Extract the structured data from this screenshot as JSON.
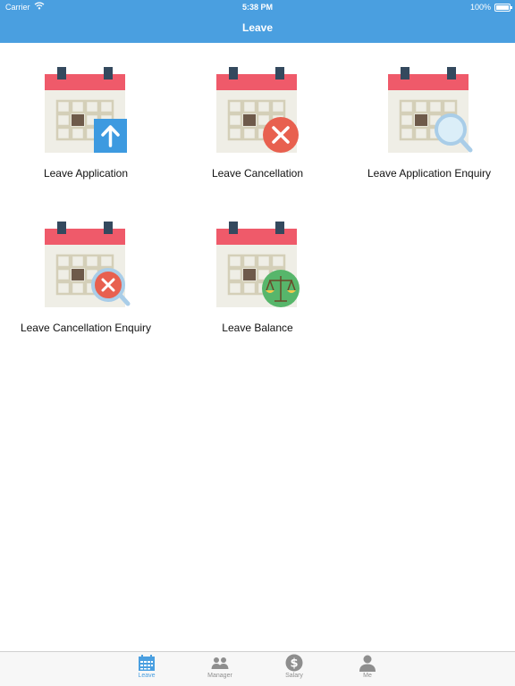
{
  "status_bar": {
    "carrier": "Carrier",
    "time": "5:38 PM",
    "battery": "100%",
    "wifi_icon": "wifi-icon",
    "battery_icon": "battery-icon"
  },
  "nav": {
    "title": "Leave"
  },
  "tiles": [
    {
      "label": "Leave Application",
      "icon": "calendar-upload-icon"
    },
    {
      "label": "Leave Cancellation",
      "icon": "calendar-cancel-icon"
    },
    {
      "label": "Leave Application Enquiry",
      "icon": "calendar-search-icon"
    },
    {
      "label": "Leave Cancellation Enquiry",
      "icon": "calendar-cancel-search-icon"
    },
    {
      "label": "Leave Balance",
      "icon": "calendar-scale-icon"
    }
  ],
  "tabbar": {
    "items": [
      {
        "label": "Leave",
        "icon": "calendar-tab-icon",
        "active": true
      },
      {
        "label": "Manager",
        "icon": "people-icon",
        "active": false
      },
      {
        "label": "Salary",
        "icon": "dollar-icon",
        "active": false
      },
      {
        "label": "Me",
        "icon": "person-icon",
        "active": false
      }
    ]
  },
  "colors": {
    "header": "#4a9fe0",
    "calendar_red": "#ef5a6a",
    "calendar_body": "#efeee6",
    "cancel_red": "#e8604f",
    "balance_green": "#57b66b",
    "tab_active": "#4a9fe0",
    "tab_inactive": "#8e8e8e"
  }
}
